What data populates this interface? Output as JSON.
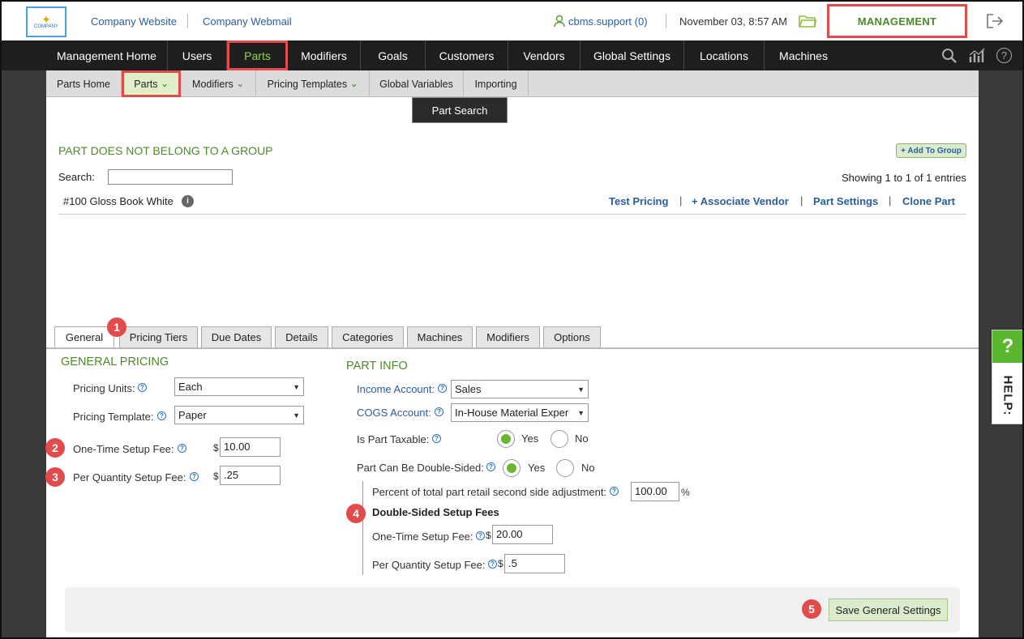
{
  "header": {
    "logo_text": "COMPANY",
    "company_website": "Company Website",
    "company_webmail": "Company Webmail",
    "user": "cbms.support (0)",
    "datetime": "November 03, 8:57 AM",
    "management": "MANAGEMENT"
  },
  "mainnav": [
    "Management Home",
    "Users",
    "Parts",
    "Modifiers",
    "Goals",
    "Customers",
    "Vendors",
    "Global Settings",
    "Locations",
    "Machines"
  ],
  "subnav": [
    "Parts Home",
    "Parts",
    "Modifiers",
    "Pricing Templates",
    "Global Variables",
    "Importing"
  ],
  "part_search": "Part Search",
  "group_title": "PART DOES NOT BELONG TO A GROUP",
  "add_to_group": "+ Add To Group",
  "search_label": "Search:",
  "showing": "Showing 1 to 1 of 1 entries",
  "part_name": "#100 Gloss Book White",
  "actions": [
    "Test Pricing",
    "+ Associate Vendor",
    "Part Settings",
    "Clone Part"
  ],
  "tabs": [
    "General",
    "Pricing Tiers",
    "Due Dates",
    "Details",
    "Categories",
    "Machines",
    "Modifiers",
    "Options"
  ],
  "general": {
    "title": "GENERAL PRICING",
    "pricing_units_label": "Pricing Units:",
    "pricing_units_value": "Each",
    "pricing_template_label": "Pricing Template:",
    "pricing_template_value": "Paper",
    "one_time_label": "One-Time Setup Fee:",
    "one_time_value": "10.00",
    "per_qty_label": "Per Quantity Setup Fee:",
    "per_qty_value": ".25",
    "currency": "$"
  },
  "partinfo": {
    "title": "PART INFO",
    "income_label": "Income Account:",
    "income_value": "Sales",
    "cogs_label": "COGS Account:",
    "cogs_value": "In-House Material Exper",
    "taxable_label": "Is Part Taxable:",
    "double_label": "Part Can Be Double-Sided:",
    "yes": "Yes",
    "no": "No",
    "percent_label": "Percent of total part retail second side adjustment:",
    "percent_value": "100.00",
    "percent_sign": "%",
    "ds_title": "Double-Sided Setup Fees",
    "ds_one_time_label": "One-Time Setup Fee:",
    "ds_one_time_value": "20.00",
    "ds_per_qty_label": "Per Quantity Setup Fee:",
    "ds_per_qty_value": ".5"
  },
  "save_button": "Save General Settings",
  "help": {
    "q": "?",
    "text": "HELP:"
  },
  "badges": [
    "1",
    "2",
    "3",
    "4",
    "5"
  ],
  "colors": {
    "accent_green": "#4c8a2a",
    "link_blue": "#2a5d9f",
    "highlight_red": "#e24b4b",
    "nav_dark": "#1e1e1e"
  }
}
